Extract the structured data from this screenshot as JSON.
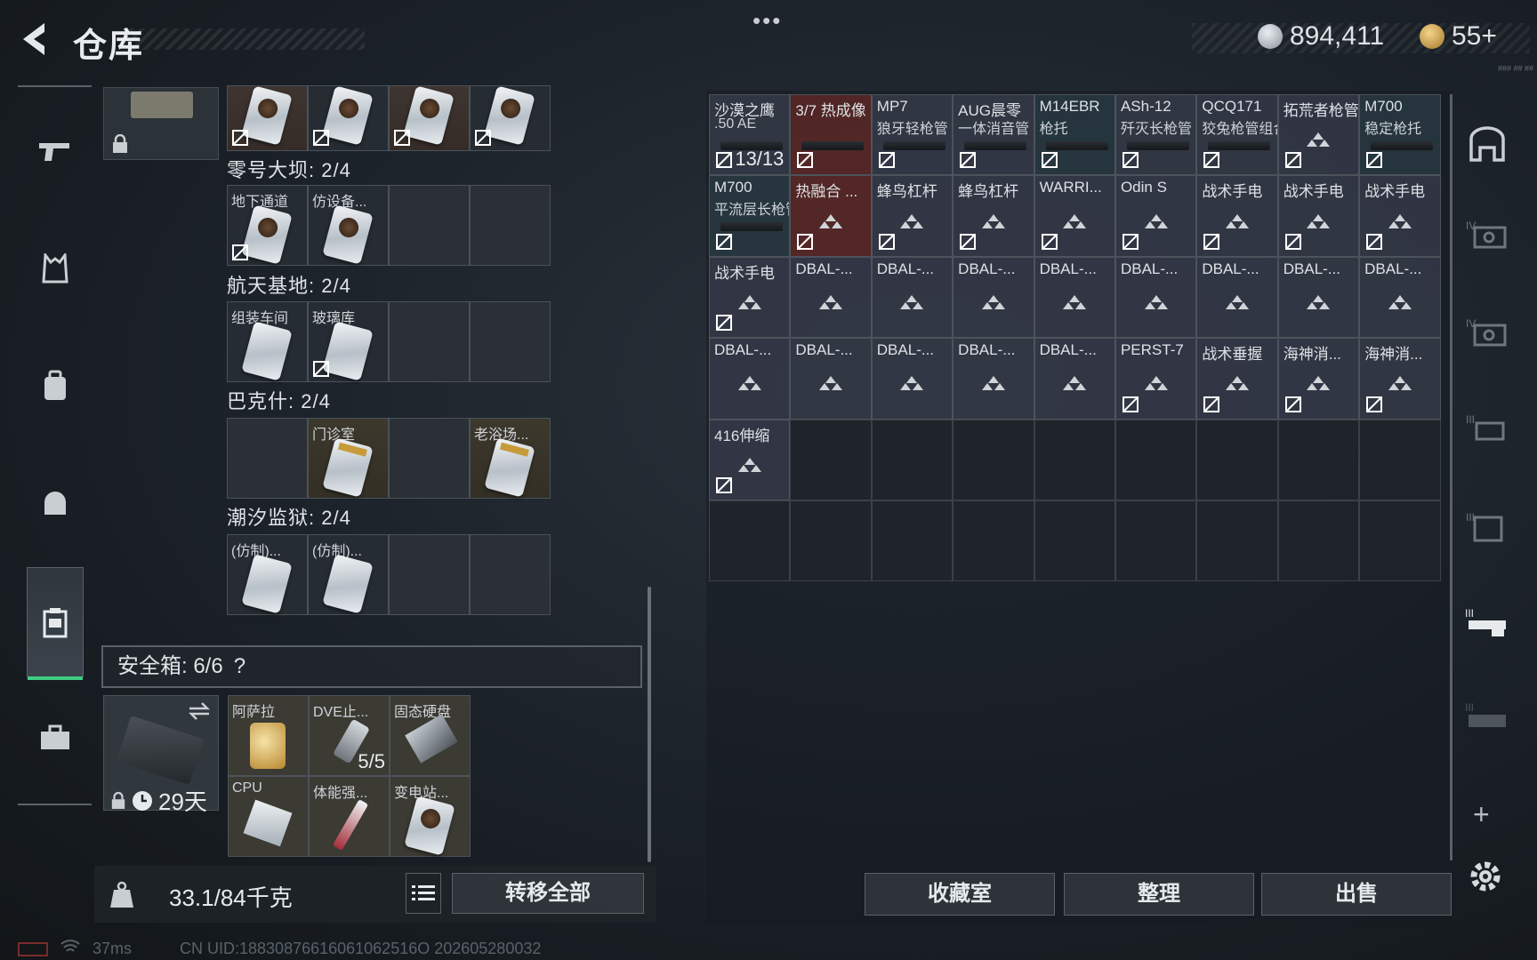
{
  "header": {
    "title": "仓库",
    "more_label": "•••",
    "currency_silver": "894,411",
    "currency_gold": "55+",
    "small_note": "### ## ##"
  },
  "containers": [
    {
      "title": "零号大坝: 2/4",
      "items": [
        "地下通道",
        "仿设备..."
      ]
    },
    {
      "title": "航天基地: 2/4",
      "items": [
        "组装车间",
        "玻璃库"
      ]
    },
    {
      "title": "巴克什: 2/4",
      "items": [
        "门诊室",
        "老浴场..."
      ]
    },
    {
      "title": "潮汐监狱: 2/4",
      "items": [
        "(仿制)...",
        "(仿制)..."
      ]
    }
  ],
  "safebox": {
    "label": "安全箱: 6/6",
    "help": "?",
    "timer": "29天",
    "items": [
      "阿萨拉",
      "DVE止...",
      "固态硬盘",
      "CPU",
      "体能强...",
      "变电站..."
    ],
    "item_count": "5/5"
  },
  "footer_left": {
    "weight": "33.1/84千克",
    "transfer_all": "转移全部"
  },
  "stash": [
    {
      "l1": "沙漠之鹰",
      "l2": ".50 AE",
      "count": "13/13",
      "style": "gun"
    },
    {
      "l1": "3/7 热成像",
      "l2": "",
      "style": "red"
    },
    {
      "l1": "MP7",
      "l2": "狼牙轻枪管",
      "style": "gun"
    },
    {
      "l1": "AUG晨零",
      "l2": "一体消音管",
      "style": "gun"
    },
    {
      "l1": "M14EBR",
      "l2": "枪托",
      "style": "teal"
    },
    {
      "l1": "ASh-12",
      "l2": "歼灭长枪管",
      "style": "gun"
    },
    {
      "l1": "QCQ171",
      "l2": "狡兔枪管组合",
      "style": "gun"
    },
    {
      "l1": "拓荒者枪管",
      "l2": "",
      "style": "tri"
    },
    {
      "l1": "M700",
      "l2": "稳定枪托",
      "style": "teal"
    },
    {
      "l1": "M700",
      "l2": "平流层长枪管",
      "style": "teal"
    },
    {
      "l1": "热融合 ...",
      "l2": "",
      "style": "red"
    },
    {
      "l1": "蜂鸟杠杆",
      "l2": "",
      "style": "tri"
    },
    {
      "l1": "蜂鸟杠杆",
      "l2": "",
      "style": "tri"
    },
    {
      "l1": "WARRI...",
      "l2": "",
      "style": "tri"
    },
    {
      "l1": "Odin S",
      "l2": "",
      "style": "tri"
    },
    {
      "l1": "战术手电",
      "l2": "",
      "style": "tri"
    },
    {
      "l1": "战术手电",
      "l2": "",
      "style": "tri"
    },
    {
      "l1": "战术手电",
      "l2": "",
      "style": "tri"
    },
    {
      "l1": "战术手电",
      "l2": "",
      "style": "tri"
    },
    {
      "l1": "DBAL-...",
      "l2": "",
      "style": "tri"
    },
    {
      "l1": "DBAL-...",
      "l2": "",
      "style": "tri"
    },
    {
      "l1": "DBAL-...",
      "l2": "",
      "style": "tri"
    },
    {
      "l1": "DBAL-...",
      "l2": "",
      "style": "tri"
    },
    {
      "l1": "DBAL-...",
      "l2": "",
      "style": "tri"
    },
    {
      "l1": "DBAL-...",
      "l2": "",
      "style": "tri"
    },
    {
      "l1": "DBAL-...",
      "l2": "",
      "style": "tri"
    },
    {
      "l1": "DBAL-...",
      "l2": "",
      "style": "tri"
    },
    {
      "l1": "DBAL-...",
      "l2": "",
      "style": "tri"
    },
    {
      "l1": "DBAL-...",
      "l2": "",
      "style": "tri"
    },
    {
      "l1": "DBAL-...",
      "l2": "",
      "style": "tri"
    },
    {
      "l1": "DBAL-...",
      "l2": "",
      "style": "tri"
    },
    {
      "l1": "DBAL-...",
      "l2": "",
      "style": "tri"
    },
    {
      "l1": "PERST-7",
      "l2": "",
      "style": "tri"
    },
    {
      "l1": "战术垂握",
      "l2": "",
      "style": "tri"
    },
    {
      "l1": "海神消...",
      "l2": "",
      "style": "tri"
    },
    {
      "l1": "海神消...",
      "l2": "",
      "style": "tri"
    },
    {
      "l1": "416伸缩",
      "l2": "",
      "style": "tri"
    }
  ],
  "actions": {
    "collection": "收藏室",
    "sort": "整理",
    "sell": "出售",
    "add": "+"
  },
  "status": {
    "ping": "37ms",
    "uid": "CN UID:18830876616061062516O 202605280032"
  },
  "colors": {
    "accent_green": "#3fce84",
    "red_tier": "#5c2826",
    "purple_tier": "#3a3e4e"
  }
}
